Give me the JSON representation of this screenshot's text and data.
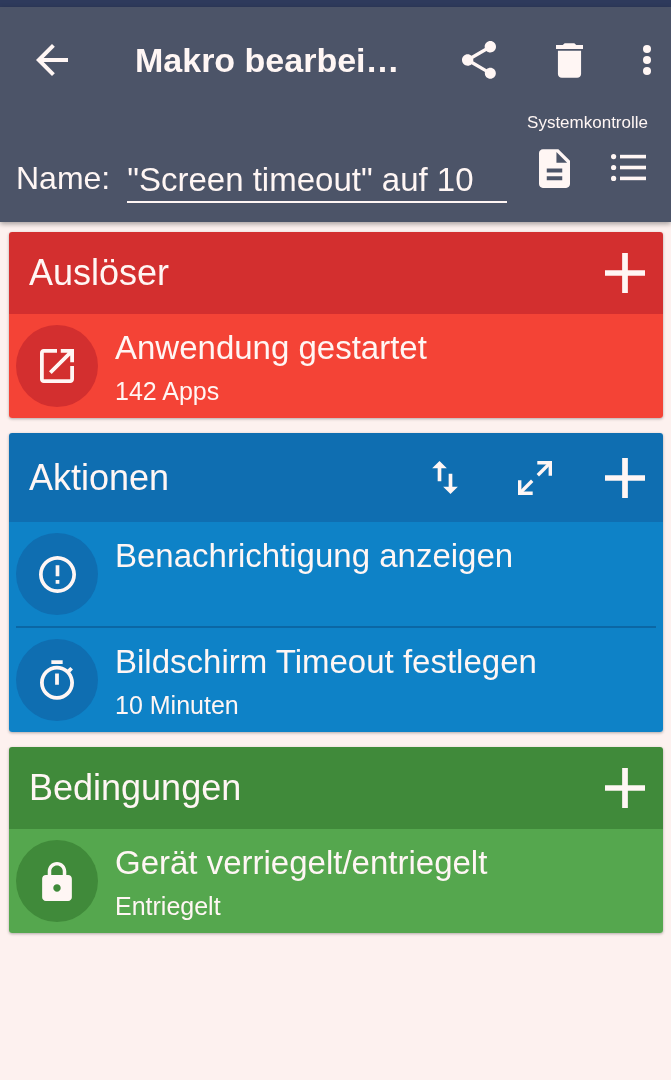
{
  "app_bar": {
    "title": "Makro bearbei…",
    "category": "Systemkontrolle",
    "name_label": "Name:",
    "name_value": "\"Screen timeout\" auf 10"
  },
  "sections": [
    {
      "kind": "trigger",
      "title": "Auslöser",
      "items": [
        {
          "title": "Anwendung gestartet",
          "subtitle": "142 Apps"
        }
      ]
    },
    {
      "kind": "action",
      "title": "Aktionen",
      "items": [
        {
          "title": "Benachrichtigung anzeigen"
        },
        {
          "title": "Bildschirm Timeout festlegen",
          "subtitle": "10 Minuten"
        }
      ]
    },
    {
      "kind": "condition",
      "title": "Bedingungen",
      "items": [
        {
          "title": "Gerät verriegelt/entriegelt",
          "subtitle": "Entriegelt"
        }
      ]
    }
  ]
}
